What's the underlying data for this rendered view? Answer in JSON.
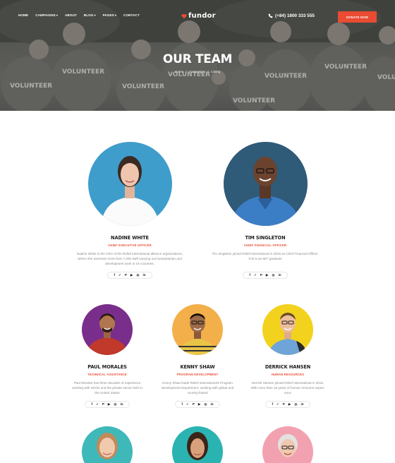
{
  "nav": {
    "items": [
      {
        "label": "HOME",
        "caret": false
      },
      {
        "label": "CAMPAIGNS",
        "caret": true
      },
      {
        "label": "ABOUT",
        "caret": false
      },
      {
        "label": "BLOG",
        "caret": true
      },
      {
        "label": "PAGES",
        "caret": true
      },
      {
        "label": "CONTACT",
        "caret": false
      }
    ],
    "caret_glyph": "▾"
  },
  "brand": {
    "name": "fundor",
    "accent": "#e94b33"
  },
  "phone": "(+84) 1800 333 555",
  "donate_label": "DONATE NOW",
  "hero": {
    "title": "OUR TEAM",
    "breadcrumb": [
      "Home",
      "/",
      "Campaigns",
      "/",
      "Listing"
    ]
  },
  "team": [
    {
      "name": "NADINE WHITE",
      "role": "CHIEF EXECUTIVE OFFICER",
      "bio": [
        "Nadine White is the CEO of the Relief International alliance organizations,",
        "where she oversees more than 7,000 staff carrying out humanitarian and",
        "development work in 16 countries."
      ],
      "bg": "#3f9dcc"
    },
    {
      "name": "TIM SINGLETON",
      "role": "CHIEF FINANCIAL OFFICER",
      "bio": [
        "Tim Singleton joined Relief International in 2018 as Chief Financial Officer.",
        "G'is is an MIT graduate"
      ],
      "bg": "#2f5a78"
    },
    {
      "name": "PAUL MORALES",
      "role": "TECHNICAL ASSISTANCE",
      "bio": [
        "Paul Morales has three decades of experience",
        "working with NGOs and the private sector both in",
        "the United States"
      ],
      "bg": "#7a2e8c"
    },
    {
      "name": "KENNY SHAW",
      "role": "PROGRAM DEVELOPMENT",
      "bio": [
        "Kenny Shaw leads Relief International's Program",
        "Development Department, working with global and",
        "country-based"
      ],
      "bg": "#f3b04a"
    },
    {
      "name": "DERRICK HANSEN",
      "role": "HUMAN RESOURCES",
      "bio": [
        "Derrick Hansen joined Relief International in 2015.",
        "With more than 18 years of human resource experi-",
        "ence"
      ],
      "bg": "#f2d21c"
    },
    {
      "bg": "#3fb8b9"
    },
    {
      "bg": "#2bb3b1"
    },
    {
      "bg": "#f2a1b0"
    }
  ],
  "social_icons": [
    "f",
    "t",
    "p",
    "y",
    "ig",
    "in"
  ],
  "social_glyphs": [
    "f",
    "✓",
    "P",
    "▶",
    "◎",
    "in"
  ]
}
